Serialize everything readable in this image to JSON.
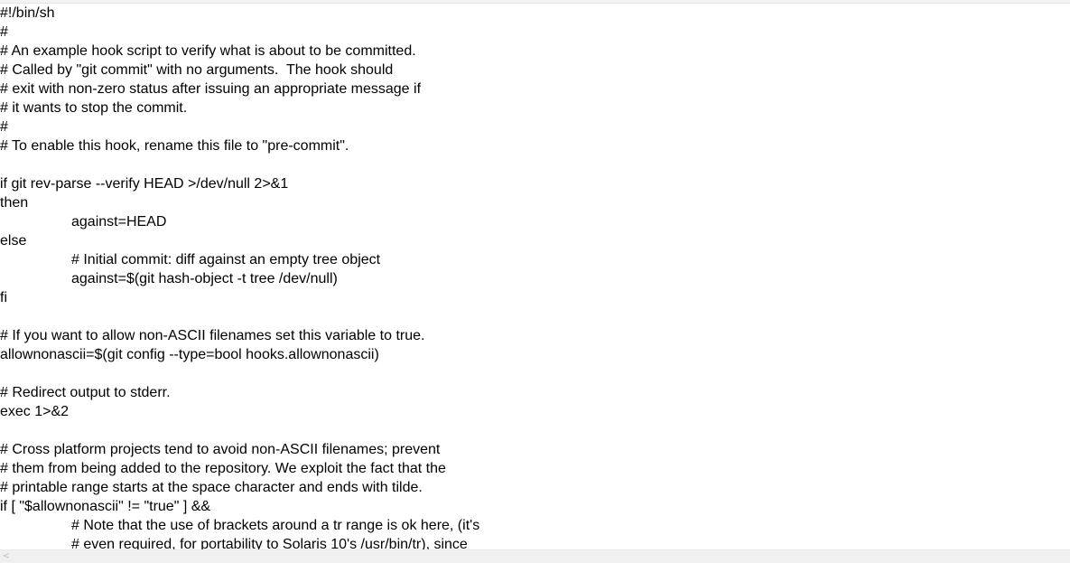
{
  "editor": {
    "lines": [
      {
        "text": "#!/bin/sh",
        "indent": false
      },
      {
        "text": "#",
        "indent": false
      },
      {
        "text": "# An example hook script to verify what is about to be committed.",
        "indent": false
      },
      {
        "text": "# Called by \"git commit\" with no arguments.  The hook should",
        "indent": false
      },
      {
        "text": "# exit with non-zero status after issuing an appropriate message if",
        "indent": false
      },
      {
        "text": "# it wants to stop the commit.",
        "indent": false
      },
      {
        "text": "#",
        "indent": false
      },
      {
        "text": "# To enable this hook, rename this file to \"pre-commit\".",
        "indent": false
      },
      {
        "text": "",
        "indent": false
      },
      {
        "text": "if git rev-parse --verify HEAD >/dev/null 2>&1",
        "indent": false
      },
      {
        "text": "then",
        "indent": false
      },
      {
        "text": "against=HEAD",
        "indent": true
      },
      {
        "text": "else",
        "indent": false
      },
      {
        "text": "# Initial commit: diff against an empty tree object",
        "indent": true
      },
      {
        "text": "against=$(git hash-object -t tree /dev/null)",
        "indent": true
      },
      {
        "text": "fi",
        "indent": false
      },
      {
        "text": "",
        "indent": false
      },
      {
        "text": "# If you want to allow non-ASCII filenames set this variable to true.",
        "indent": false
      },
      {
        "text": "allownonascii=$(git config --type=bool hooks.allownonascii)",
        "indent": false
      },
      {
        "text": "",
        "indent": false
      },
      {
        "text": "# Redirect output to stderr.",
        "indent": false
      },
      {
        "text": "exec 1>&2",
        "indent": false
      },
      {
        "text": "",
        "indent": false
      },
      {
        "text": "# Cross platform projects tend to avoid non-ASCII filenames; prevent",
        "indent": false
      },
      {
        "text": "# them from being added to the repository. We exploit the fact that the",
        "indent": false
      },
      {
        "text": "# printable range starts at the space character and ends with tilde.",
        "indent": false
      },
      {
        "text": "if [ \"$allownonascii\" != \"true\" ] &&",
        "indent": false
      },
      {
        "text": "# Note that the use of brackets around a tr range is ok here, (it's",
        "indent": true
      },
      {
        "text": "# even required, for portability to Solaris 10's /usr/bin/tr), since",
        "indent": true
      }
    ]
  },
  "scrollbar": {
    "left_arrow_icon": "<"
  }
}
